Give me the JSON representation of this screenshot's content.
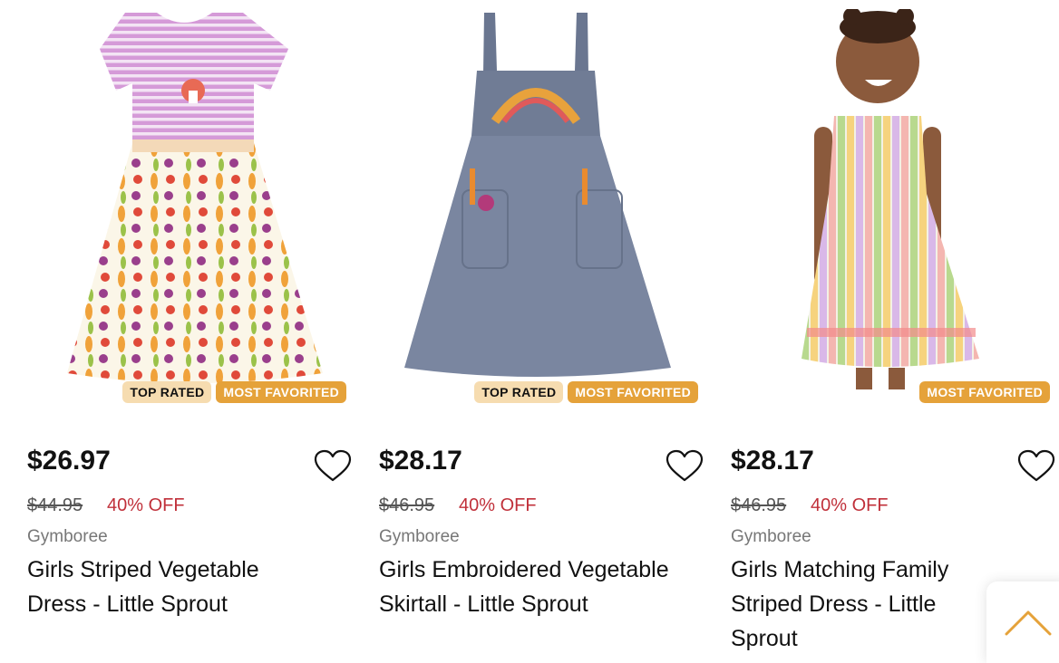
{
  "products": [
    {
      "price": "$26.97",
      "original_price": "$44.95",
      "discount": "40% OFF",
      "brand": "Gymboree",
      "title": "Girls Striped Vegetable Dress - Little Sprout",
      "badges": [
        "TOP RATED",
        "MOST FAVORITED"
      ],
      "image_icon": "dress-image"
    },
    {
      "price": "$28.17",
      "original_price": "$46.95",
      "discount": "40% OFF",
      "brand": "Gymboree",
      "title": "Girls Embroidered Vegetable Skirtall - Little Sprout",
      "badges": [
        "TOP RATED",
        "MOST FAVORITED"
      ],
      "image_icon": "skirtall-image"
    },
    {
      "price": "$28.17",
      "original_price": "$46.95",
      "discount": "40% OFF",
      "brand": "Gymboree",
      "title": "Girls Matching Family Striped Dress - Little Sprout",
      "badges": [
        "MOST FAVORITED"
      ],
      "image_icon": "model-dress-image"
    }
  ],
  "colors": {
    "top_rated_bg": "#f6dcb0",
    "favorited_bg": "#e5a23a",
    "discount": "#c0303a",
    "scroll_arrow": "#e5a23a"
  },
  "icons": {
    "favorite": "heart-icon",
    "scroll_top": "chevron-up-icon"
  }
}
